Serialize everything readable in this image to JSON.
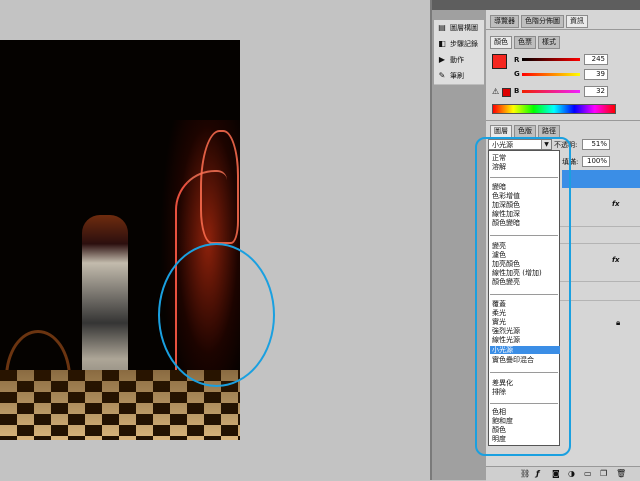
{
  "side_panel": {
    "items": [
      {
        "label": "圖層構圖",
        "icon": "layer-comps-icon"
      },
      {
        "label": "步驟記錄",
        "icon": "history-icon"
      },
      {
        "label": "動作",
        "icon": "actions-play-icon"
      },
      {
        "label": "筆刷",
        "icon": "brush-icon"
      }
    ]
  },
  "top_tabs": [
    "導覽器",
    "色階分佈圖",
    "資訊"
  ],
  "color_panel": {
    "tabs": [
      "顏色",
      "色票",
      "樣式"
    ],
    "sliders": [
      {
        "label": "R",
        "value": "245"
      },
      {
        "label": "G",
        "value": "39"
      },
      {
        "label": "B",
        "value": "32"
      }
    ],
    "foreground_color": "#f52720",
    "background_color": "#000000"
  },
  "layers_panel": {
    "tabs": [
      "圖層",
      "色版",
      "路徑"
    ],
    "blend_mode": "小光源",
    "opacity_label": "不透明:",
    "opacity_value": "51%",
    "fill_label": "填滿:",
    "fill_value": "100%",
    "fx_label": "fx"
  },
  "blend_modes": [
    [
      "正常",
      "溶解"
    ],
    [
      "變暗",
      "色彩增值",
      "加深顏色",
      "線性加深",
      "顏色變暗"
    ],
    [
      "變亮",
      "濾色",
      "加亮顏色",
      "線性加亮 (增加)",
      "顏色變亮"
    ],
    [
      "覆蓋",
      "柔光",
      "實光",
      "強烈光源",
      "線性光源",
      "小光源",
      "實色疊印混合"
    ],
    [
      "差異化",
      "排除"
    ],
    [
      "色相",
      "飽和度",
      "顏色",
      "明度"
    ]
  ],
  "selected_blend_mode": "小光源",
  "accent_color": "#1aa0e0"
}
